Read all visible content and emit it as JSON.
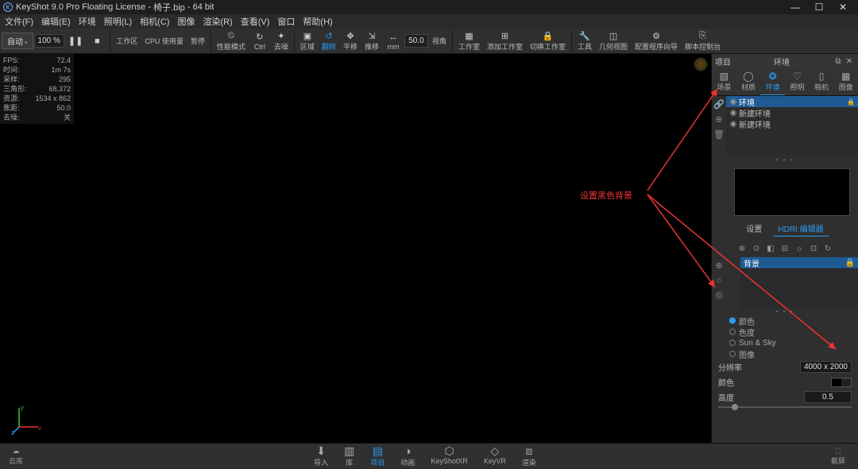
{
  "titlebar": {
    "app": "KeyShot 9.0 Pro Floating License",
    "file": "椅子.bip",
    "suffix": "64 bit"
  },
  "winbuttons": {
    "min": "—",
    "max": "☐",
    "close": "✕"
  },
  "menu": [
    "文件(F)",
    "编辑(E)",
    "环境",
    "照明(L)",
    "相机(C)",
    "图像",
    "渲染(R)",
    "查看(V)",
    "窗口",
    "帮助(H)"
  ],
  "toolbar": {
    "auto": "自动",
    "pct": "100 %",
    "pause": "❚❚",
    "stop": "■",
    "workspace": "工作区",
    "cpu": "CPU 使用量",
    "pause2": "暂停",
    "perfmode": "性能模式",
    "ctrl": "Ctrl",
    "denoise": "去噪",
    "region": "区域",
    "tumble": "翻转",
    "pan": "平移",
    "dolly": "推移",
    "mm": "mm",
    "val": "50.0",
    "perspective": "视角",
    "studio": "工作室",
    "addstudio": "添加工作室",
    "lock": "切换工作室",
    "tools": "工具",
    "geomview": "几何视图",
    "setupwiz": "配置程序向导",
    "scriptconsole": "脚本控制台"
  },
  "stats": {
    "fps_k": "FPS:",
    "fps_v": "72.4",
    "time_k": "时间:",
    "time_v": "1m 7s",
    "samples_k": "采样:",
    "samples_v": "295",
    "tri_k": "三角形:",
    "tri_v": "68,372",
    "res_k": "资源:",
    "res_v": "1534 x 862",
    "focal_k": "焦距:",
    "focal_v": "50.0",
    "denoise_k": "去噪:",
    "denoise_v": "关"
  },
  "annotation": "设置黑色背景",
  "panel": {
    "title_l": "项目",
    "title_c": "环境",
    "tabs": [
      {
        "icon": "▧",
        "label": "场景"
      },
      {
        "icon": "◯",
        "label": "材质"
      },
      {
        "icon": "❂",
        "label": "环境"
      },
      {
        "icon": "♡",
        "label": "照明"
      },
      {
        "icon": "▯",
        "label": "相机"
      },
      {
        "icon": "▦",
        "label": "图像"
      }
    ],
    "env_items": [
      {
        "label": "环境",
        "sel": true
      },
      {
        "label": "新建环境",
        "sel": false
      },
      {
        "label": "新建环境",
        "sel": false
      }
    ],
    "subtabs": {
      "settings": "设置",
      "hdri": "HDRI 编辑器"
    },
    "icons": [
      "⊕",
      "⊙",
      "◧",
      "⊟",
      "☼",
      "⊡",
      "↻"
    ],
    "bg_label": "背景",
    "radios": [
      {
        "label": "颜色",
        "sel": true
      },
      {
        "label": "色度",
        "sel": false
      },
      {
        "label": "Sun & Sky",
        "sel": false
      },
      {
        "label": "图像",
        "sel": false
      }
    ],
    "res_label": "分辨率",
    "res_val": "4000 x 2000",
    "color_label": "颜色",
    "height_label": "高度",
    "height_val": "0.5"
  },
  "bottom": {
    "cloud": "云库",
    "items": [
      {
        "icon": "⬇",
        "label": "导入"
      },
      {
        "icon": "▥",
        "label": "库"
      },
      {
        "icon": "▤",
        "label": "项目",
        "act": true
      },
      {
        "icon": "◑",
        "label": "动画"
      },
      {
        "icon": "⬡",
        "label": "KeyShotXR"
      },
      {
        "icon": "◇",
        "label": "KeyVR"
      },
      {
        "icon": "⧈",
        "label": "渲染"
      }
    ],
    "screenshot": "截屏"
  }
}
